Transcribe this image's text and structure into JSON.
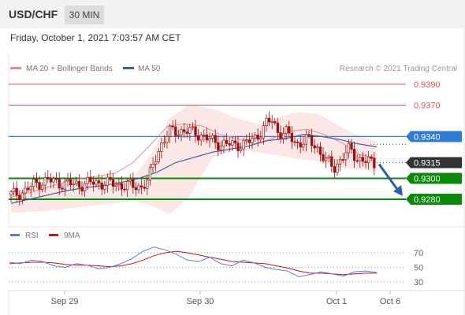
{
  "header": {
    "symbol": "USD/CHF",
    "timeframe": "30 MIN"
  },
  "timestamp": "Friday, October 1, 2021 7:03:57 AM CET",
  "legend": {
    "ma20_label": "MA 20 + Bollinger Bands",
    "ma50_label": "MA 50",
    "copyright": "Research © 2021 Trading Central",
    "rsi_label": "RSI",
    "rsi9_label": "9MA"
  },
  "colors": {
    "ma20": "#f08a8a",
    "ma50": "#3a5fa0",
    "resistance": "#e55050",
    "pivot": "#2f7bd6",
    "support": "#0a8a0a",
    "current": "#333333",
    "candle": "#9e1010",
    "rsi": "#5b7fd9",
    "rsi_ma": "#cc1111",
    "arrow": "#2c5faa"
  },
  "chart_data": [
    {
      "type": "candlestick",
      "title": "USD/CHF",
      "timeframe": "30 MIN",
      "x_ticks": [
        "Sep 29",
        "Sep 30",
        "Oct 1",
        "Oct 6"
      ],
      "y_range": [
        0.9262,
        0.9398
      ],
      "levels": [
        {
          "label": "0.9390",
          "value": 0.939,
          "kind": "resistance"
        },
        {
          "label": "0.9370",
          "value": 0.937,
          "kind": "resistance"
        },
        {
          "label": "0.9340",
          "value": 0.934,
          "kind": "pivot"
        },
        {
          "label": "0.9315",
          "value": 0.9315,
          "kind": "current"
        },
        {
          "label": "0.9300",
          "value": 0.93,
          "kind": "support"
        },
        {
          "label": "0.9280",
          "value": 0.928,
          "kind": "support"
        }
      ],
      "forecast": {
        "direction": "down",
        "from": 0.9315,
        "to": 0.9283
      },
      "series": [
        {
          "name": "MA 20 + Bollinger Bands",
          "values": [
            0.9282,
            0.9286,
            0.9291,
            0.9296,
            0.93,
            0.9302,
            0.9305,
            0.9315,
            0.9332,
            0.935,
            0.9352,
            0.935,
            0.9342,
            0.9338,
            0.9333,
            0.9338,
            0.9345,
            0.9347,
            0.9342,
            0.9334,
            0.9323,
            0.9319
          ]
        },
        {
          "name": "MA 50",
          "values": [
            0.9276,
            0.928,
            0.9284,
            0.9288,
            0.9291,
            0.9293,
            0.9296,
            0.93,
            0.9306,
            0.9315,
            0.932,
            0.9325,
            0.9328,
            0.9331,
            0.9336,
            0.9338,
            0.9342,
            0.934,
            0.9337,
            0.9333,
            0.933
          ]
        }
      ]
    },
    {
      "type": "line",
      "title": "RSI",
      "y_ticks": [
        30,
        50,
        70
      ],
      "y_range": [
        20,
        80
      ],
      "series": [
        {
          "name": "RSI",
          "values": [
            57,
            55,
            60,
            58,
            52,
            50,
            55,
            53,
            48,
            50,
            55,
            62,
            72,
            78,
            74,
            68,
            60,
            58,
            64,
            55,
            52,
            60,
            56,
            50,
            47,
            45,
            37,
            40,
            44,
            41,
            38,
            44,
            45,
            43
          ]
        },
        {
          "name": "9MA",
          "values": [
            55,
            56,
            57,
            57,
            56,
            54,
            53,
            53,
            52,
            51,
            52,
            55,
            60,
            66,
            70,
            72,
            70,
            67,
            64,
            61,
            58,
            57,
            56,
            55,
            52,
            49,
            45,
            42,
            42,
            41,
            40,
            41,
            42,
            42
          ]
        }
      ]
    }
  ]
}
